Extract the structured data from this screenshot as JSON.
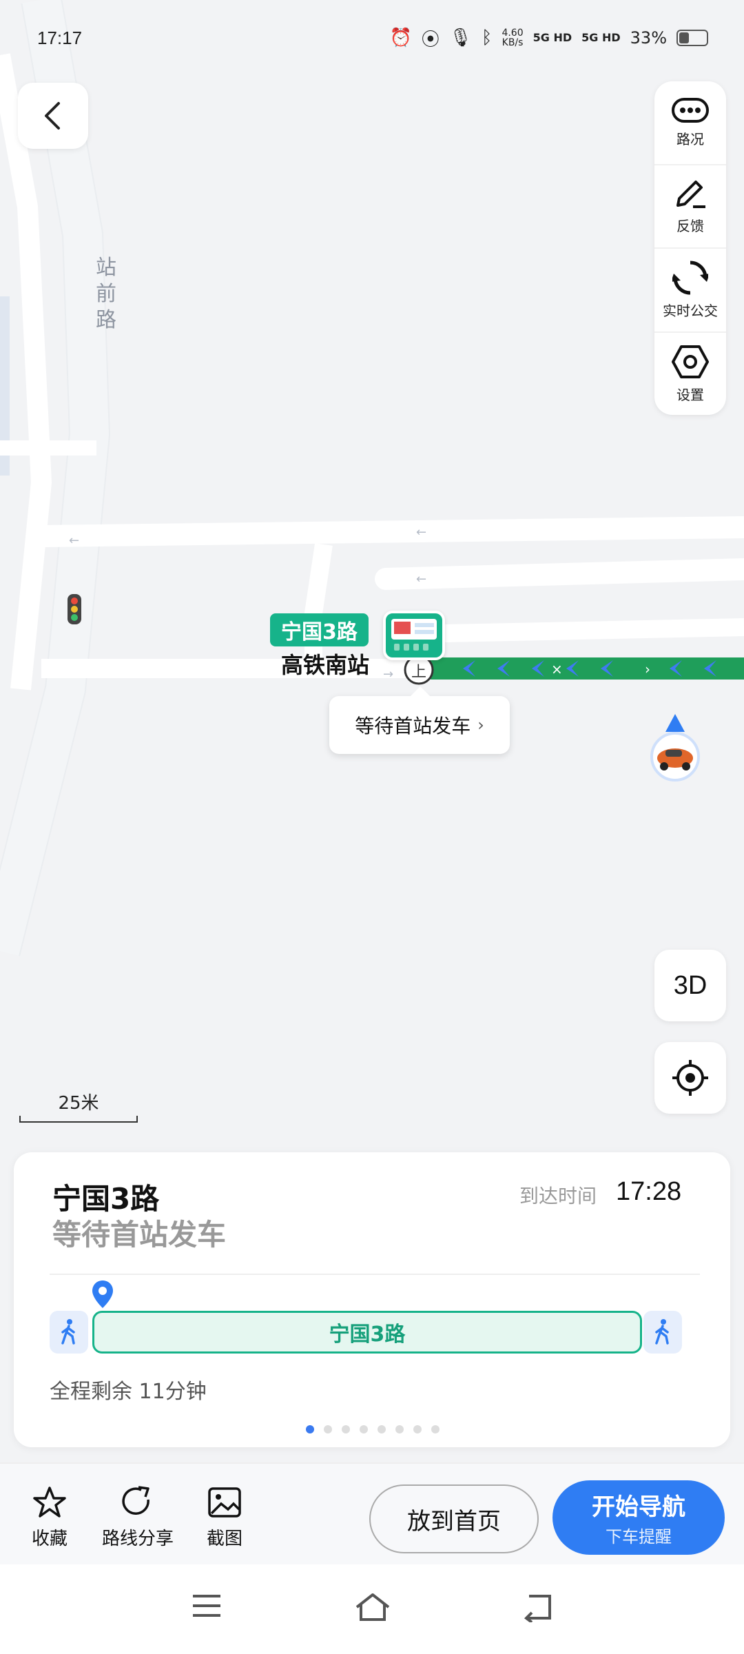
{
  "status_bar": {
    "time": "17:17",
    "net_speed_value": "4.60",
    "net_speed_unit": "KB/s",
    "network_1": "5G HD",
    "network_2": "5G HD",
    "battery": "33%"
  },
  "map": {
    "road_name": "站前路",
    "route_tag": "宁国3路",
    "station_name": "高铁南站",
    "wait_bubble": "等待首站发车",
    "scale_label": "25米",
    "accent_green": "#16b38a",
    "route_blue": "#2f7df3"
  },
  "right_panel": {
    "items": [
      {
        "label": "路况",
        "icon": "traffic-dots-icon"
      },
      {
        "label": "反馈",
        "icon": "pencil-icon"
      },
      {
        "label": "实时公交",
        "icon": "refresh-icon"
      },
      {
        "label": "设置",
        "icon": "hexagon-settings-icon"
      }
    ]
  },
  "controls": {
    "btn_3d": "3D"
  },
  "card": {
    "route_name": "宁国3路",
    "status": "等待首站发车",
    "arrive_label": "到达时间",
    "arrive_time": "17:28",
    "bus_bar_label": "宁国3路",
    "remain": "全程剩余 11分钟",
    "page_count": 8,
    "active_page": 1
  },
  "actions": {
    "favorite": "收藏",
    "share": "路线分享",
    "screenshot": "截图",
    "to_home": "放到首页",
    "start_nav": "开始导航",
    "start_nav_sub": "下车提醒"
  }
}
